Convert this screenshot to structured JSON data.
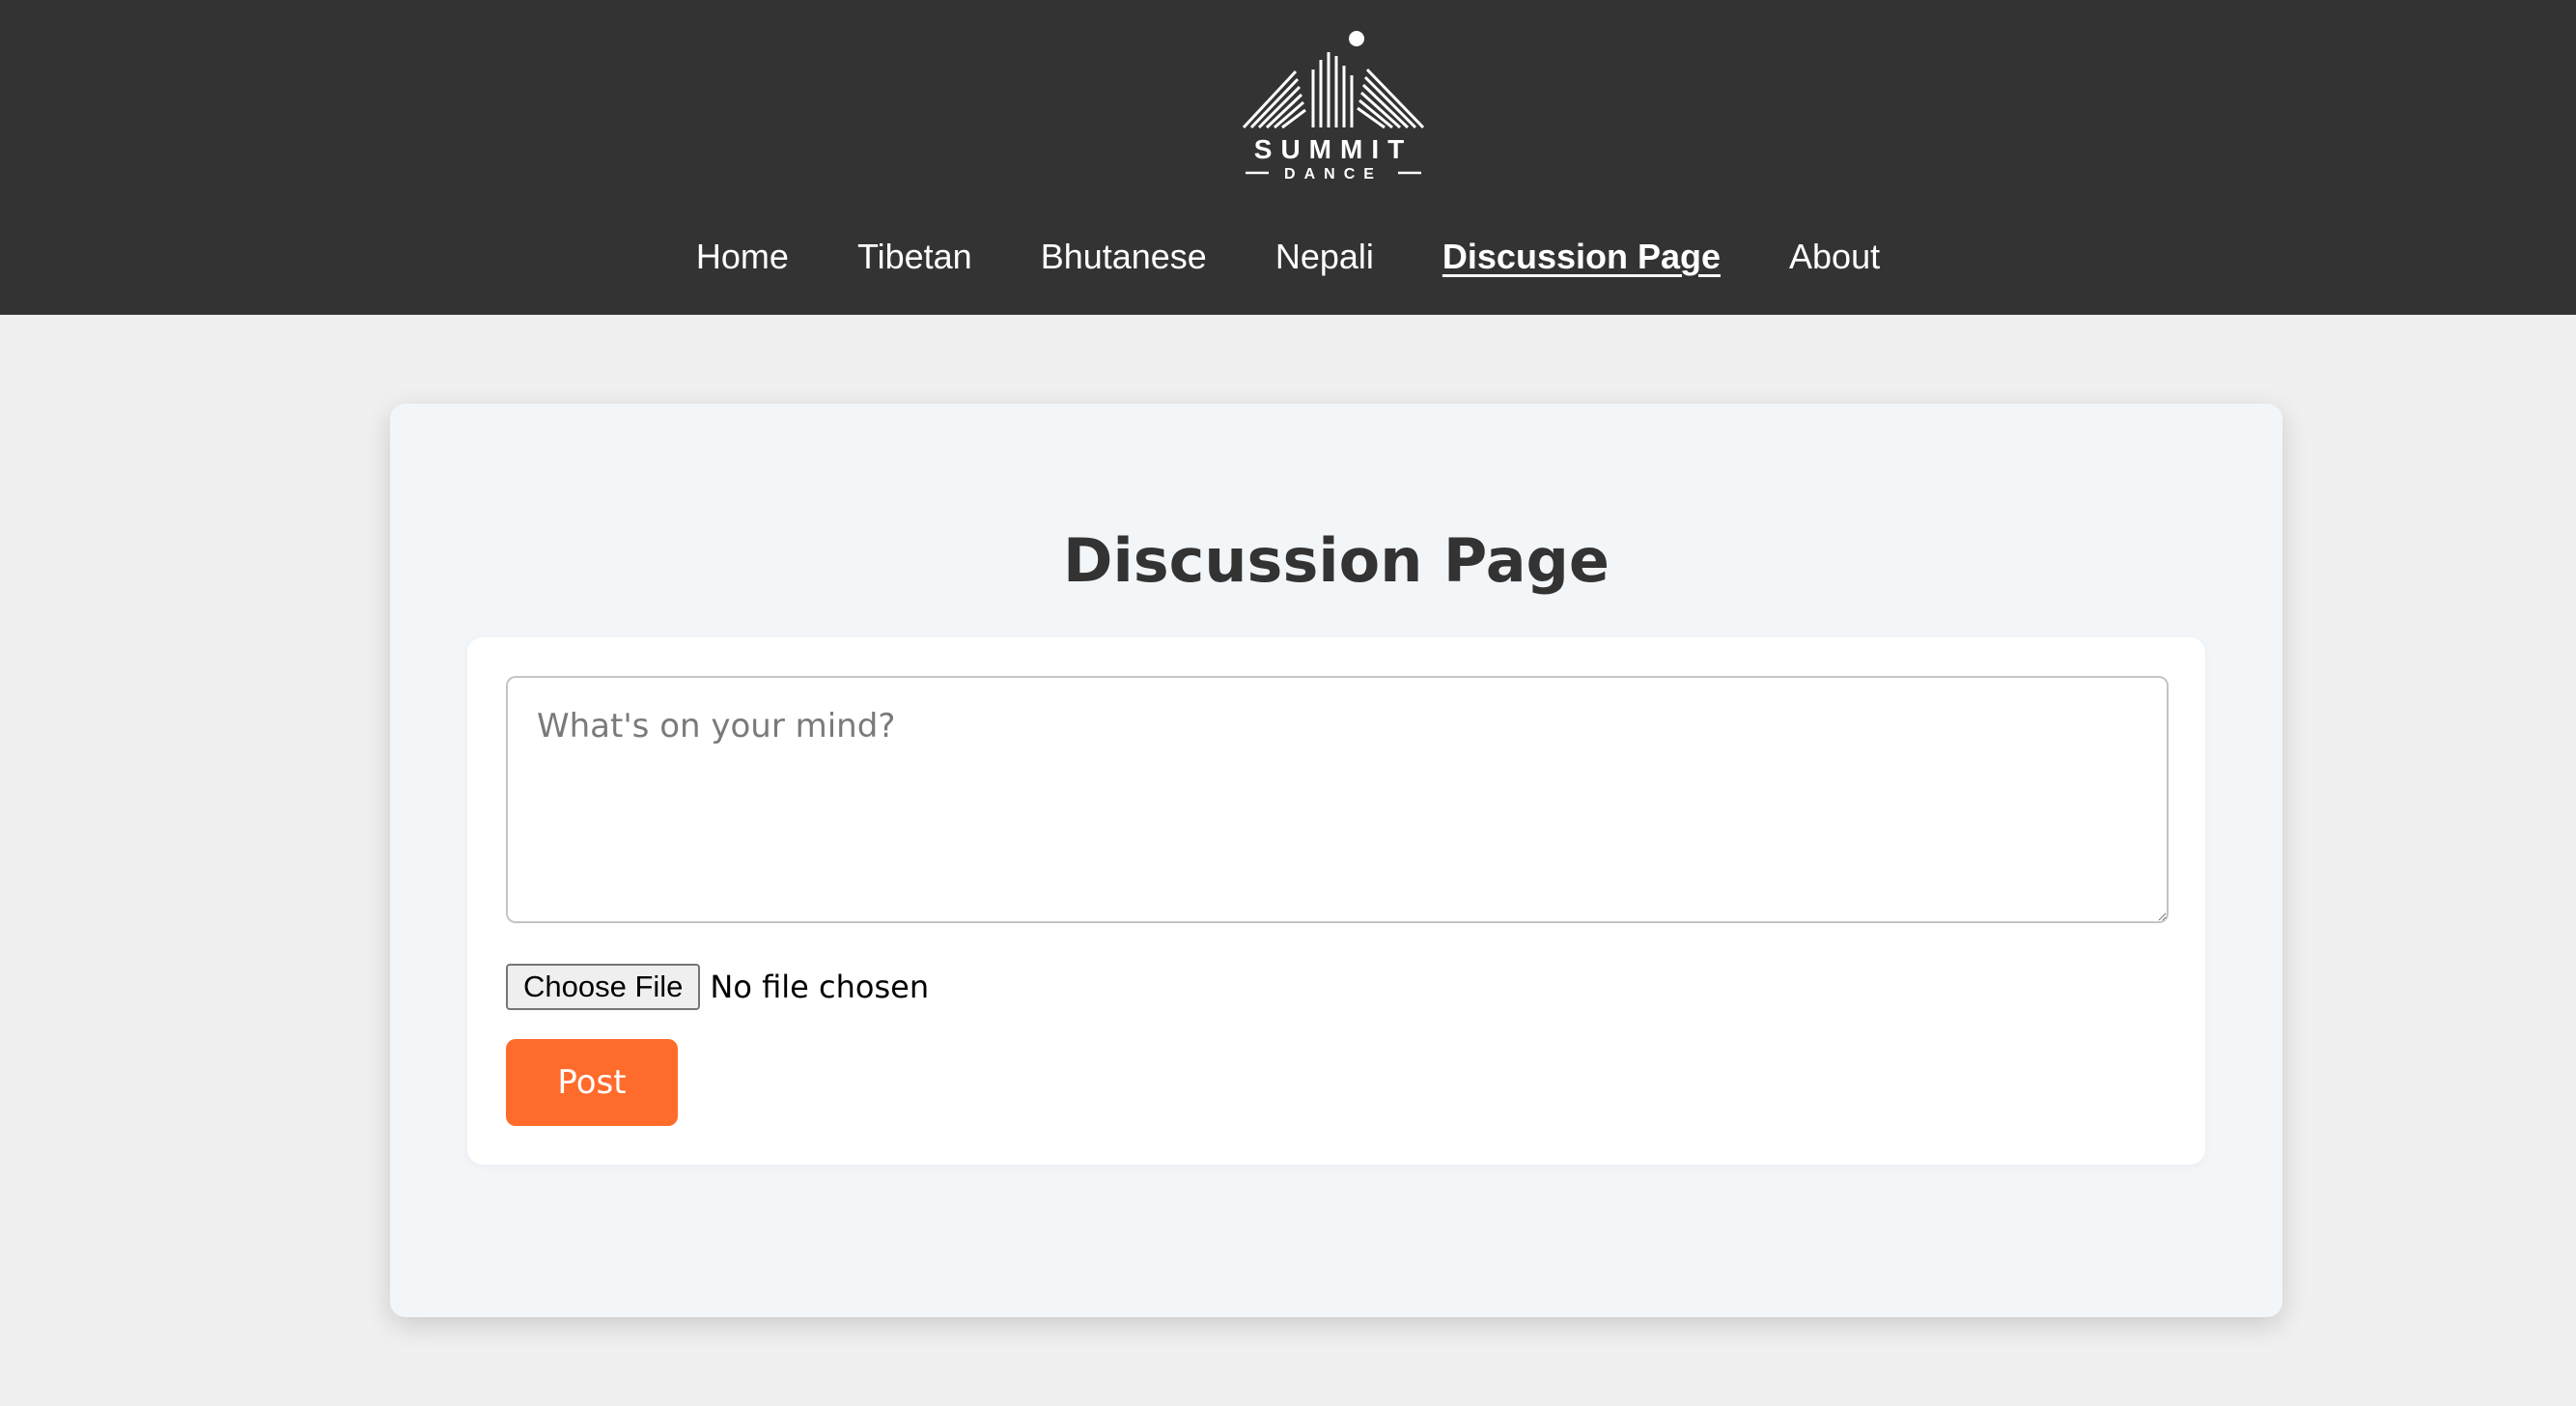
{
  "brand": {
    "name": "SUMMIT",
    "tagline": "DANCE"
  },
  "nav": {
    "items": [
      {
        "label": "Home"
      },
      {
        "label": "Tibetan"
      },
      {
        "label": "Bhutanese"
      },
      {
        "label": "Nepali"
      },
      {
        "label": "Discussion Page",
        "active": true
      },
      {
        "label": "About"
      }
    ]
  },
  "main": {
    "title": "Discussion Page",
    "post_form": {
      "textarea_value": "",
      "textarea_placeholder": "What's on your mind?",
      "file_button_label": "Choose File",
      "file_status": "No file chosen",
      "submit_label": "Post"
    }
  },
  "colors": {
    "header_bg": "#333333",
    "page_bg": "#f0f0f0",
    "card_bg": "#f3f6f9",
    "accent": "#ff6b2b"
  },
  "icons": {
    "logo": "summit-mountain-logo"
  }
}
